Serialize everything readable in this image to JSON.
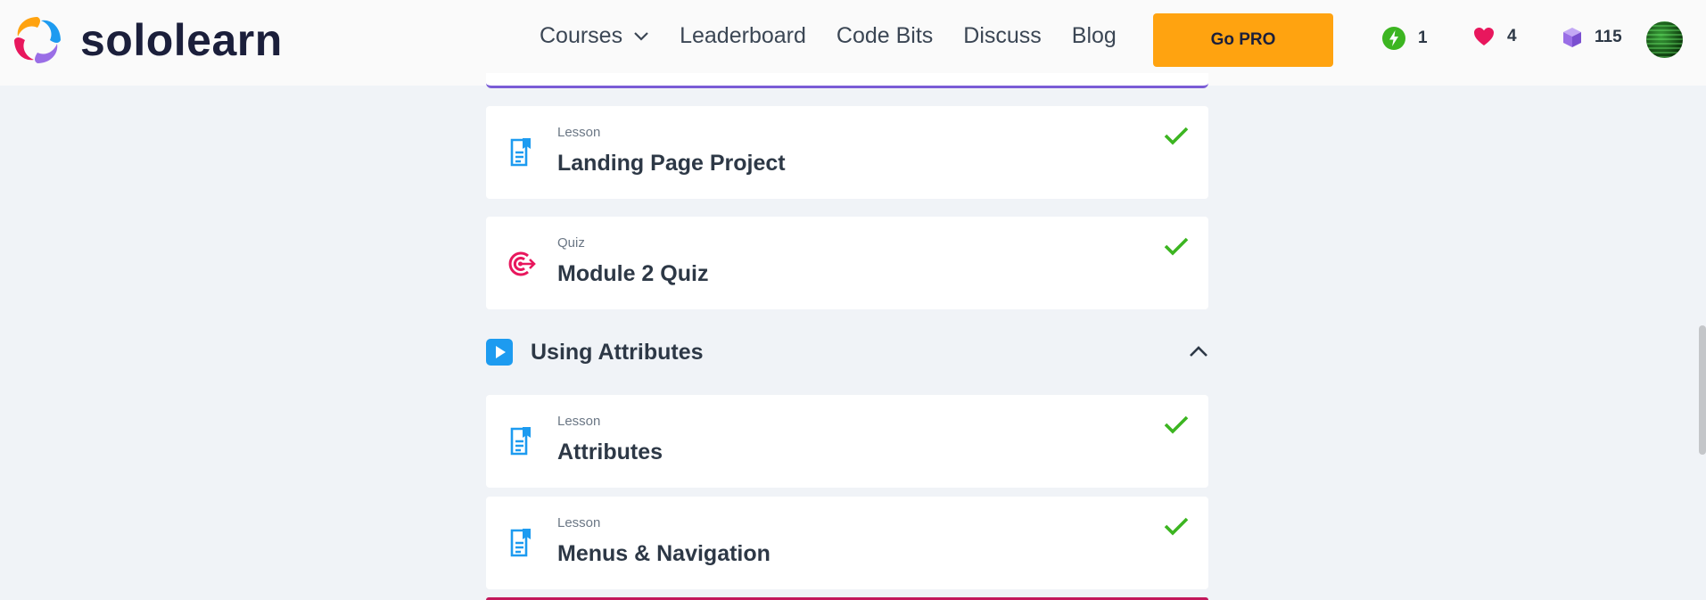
{
  "brand": {
    "name": "sololearn"
  },
  "nav": {
    "items": [
      {
        "label": "Courses",
        "has_dropdown": true
      },
      {
        "label": "Leaderboard"
      },
      {
        "label": "Code Bits"
      },
      {
        "label": "Discuss"
      },
      {
        "label": "Blog"
      }
    ]
  },
  "go_pro": {
    "label": "Go PRO",
    "color": "#ffa310"
  },
  "stats": {
    "streak": {
      "value": "1",
      "icon": "lightning-icon",
      "color": "#3cb521"
    },
    "hearts": {
      "value": "4",
      "icon": "heart-icon",
      "color": "#e8175d"
    },
    "bits": {
      "value": "115",
      "icon": "cube-icon",
      "color": "#9a6ee6"
    }
  },
  "cards": [
    {
      "type": "Lesson",
      "title": "Landing Page Project",
      "icon": "document-icon",
      "completed": true
    },
    {
      "type": "Quiz",
      "title": "Module 2 Quiz",
      "icon": "target-icon",
      "completed": true
    }
  ],
  "section": {
    "title": "Using Attributes",
    "icon": "play-icon",
    "expanded": true
  },
  "section_cards": [
    {
      "type": "Lesson",
      "title": "Attributes",
      "icon": "document-icon",
      "completed": true
    },
    {
      "type": "Lesson",
      "title": "Menus & Navigation",
      "icon": "document-icon",
      "completed": true
    }
  ],
  "colors": {
    "accent_purple": "#7a5cd6",
    "check_green": "#3cb521",
    "lesson_blue": "#1d9bf0",
    "quiz_pink": "#e8175d"
  }
}
